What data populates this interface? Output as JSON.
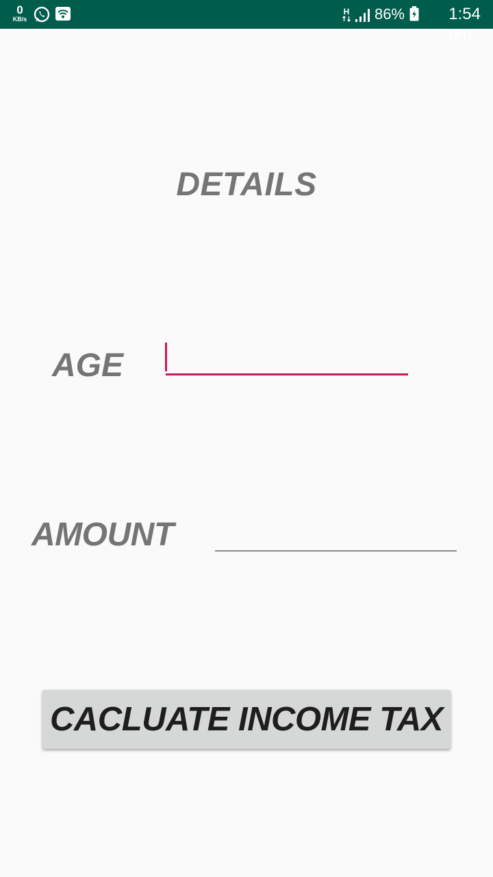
{
  "status_bar": {
    "net_speed_value": "0",
    "net_speed_unit": "KB/s",
    "network_type": "H",
    "battery_percent": "86%",
    "time": "1:54 pm",
    "background_color": "#005c4b",
    "icons": [
      "whatsapp-icon",
      "wifi-icon",
      "h-network-icon",
      "signal-icon",
      "battery-charging-icon"
    ]
  },
  "screen": {
    "title": "DETAILS",
    "age_label": "AGE",
    "age_value": "",
    "amount_label": "AMOUNT",
    "amount_value": "",
    "calculate_button_label": "CACLUATE INCOME TAX"
  },
  "colors": {
    "label_gray": "#757575",
    "focus_accent": "#c2185b",
    "button_bg": "#d6d7d7"
  }
}
